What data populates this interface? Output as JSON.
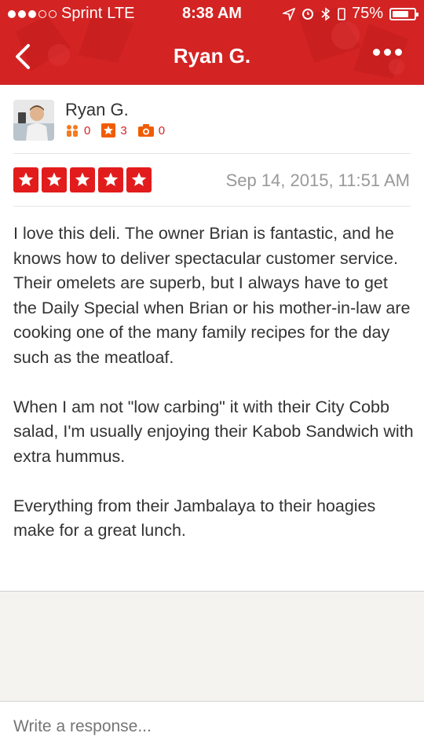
{
  "status_bar": {
    "carrier": "Sprint",
    "network": "LTE",
    "time": "8:38 AM",
    "battery": "75%",
    "battery_level": 0.75,
    "signal_bars_filled": 3,
    "signal_bars_total": 5
  },
  "nav": {
    "title": "Ryan G.",
    "back_icon": "chevron-left-icon",
    "more_icon": "more-dots-icon"
  },
  "user": {
    "name": "Ryan G.",
    "friends_count": "0",
    "reviews_count": "3",
    "photos_count": "0"
  },
  "review": {
    "rating": 5,
    "date": "Sep 14, 2015, 11:51 AM",
    "paragraphs": [
      "I love this deli. The owner Brian is fantastic, and he knows how to deliver spectacular customer service. Their omelets are superb, but I always have to get the Daily Special when Brian or his mother-in-law are cooking one of the many family recipes for the day such as the meatloaf.",
      "When I am not \"low carbing\" it with their City Cobb salad, I'm usually enjoying their Kabob Sandwich with extra hummus.",
      "Everything from their Jambalaya to their hoagies make for a great lunch."
    ]
  },
  "response": {
    "placeholder": "Write a response..."
  },
  "colors": {
    "brand": "#d32323",
    "star": "#e21c1c"
  }
}
